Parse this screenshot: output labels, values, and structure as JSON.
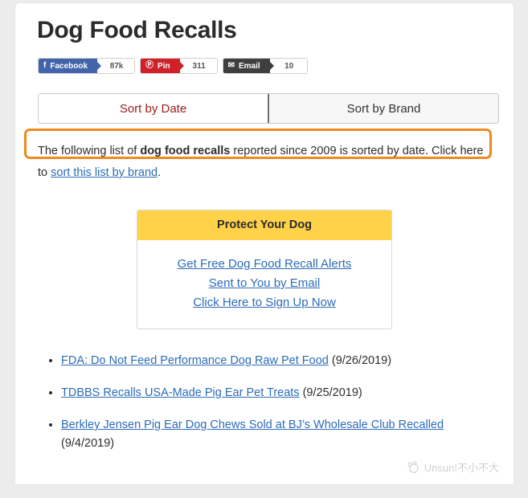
{
  "page": {
    "title": "Dog Food Recalls"
  },
  "share_buttons": [
    {
      "network": "Facebook",
      "label": "Facebook",
      "count": "87k",
      "icon": "facebook-icon",
      "glyph": "f",
      "color": "#4264aa"
    },
    {
      "network": "Pinterest",
      "label": "Pin",
      "count": "311",
      "icon": "pinterest-icon",
      "glyph": "Ⓟ",
      "color": "#cf2128"
    },
    {
      "network": "Email",
      "label": "Email",
      "count": "10",
      "icon": "envelope-icon",
      "glyph": "✉",
      "color": "#3f3f3f"
    }
  ],
  "tabs": [
    {
      "label": "Sort by Date",
      "active": true
    },
    {
      "label": "Sort by Brand",
      "active": false
    }
  ],
  "intro": {
    "text_1": "The following list of ",
    "bold": "dog food recalls",
    "text_2": " reported since 2009 is sorted by date. Click here to ",
    "link": "sort this list by brand",
    "text_3": "."
  },
  "annotation": {
    "color": "#f08a1e"
  },
  "promo": {
    "header": "Protect Your Dog",
    "header_color": "#ffd24a",
    "lines": [
      "Get Free Dog Food Recall Alerts",
      "Sent to You by Email",
      "Click Here to Sign Up Now"
    ]
  },
  "recalls": [
    {
      "title": "FDA: Do Not Feed Performance Dog Raw Pet Food",
      "date": "(9/26/2019)"
    },
    {
      "title": "TDBBS Recalls USA-Made Pig Ear Pet Treats",
      "date": "(9/25/2019)"
    },
    {
      "title": "Berkley Jensen Pig Ear Dog Chews Sold at BJ’s Wholesale Club Recalled",
      "date": "(9/4/2019)"
    }
  ],
  "watermark": {
    "text": "Unsun!不小不大"
  }
}
